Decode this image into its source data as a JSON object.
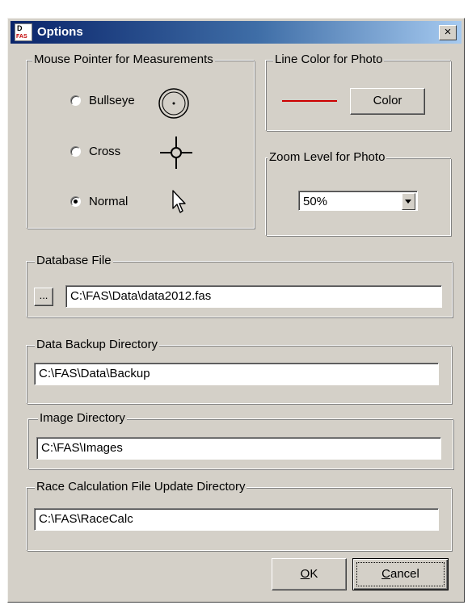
{
  "window": {
    "title": "Options",
    "icon": "fas-app-icon",
    "icon_text_top": "D",
    "icon_text_bottom": "FAS",
    "close_label": "×"
  },
  "mouse_pointer": {
    "title": "Mouse Pointer for Measurements",
    "options": [
      {
        "label": "Bullseye",
        "icon": "bullseye-icon",
        "selected": false
      },
      {
        "label": "Cross",
        "icon": "crosshair-icon",
        "selected": false
      },
      {
        "label": "Normal",
        "icon": "arrow-pointer-icon",
        "selected": true
      }
    ]
  },
  "line_color": {
    "title": "Line Color for Photo",
    "button_label": "Color",
    "swatch_color": "#cc0000"
  },
  "zoom": {
    "title": "Zoom Level for Photo",
    "value": "50%"
  },
  "database": {
    "title": "Database File",
    "browse_label": "...",
    "path": "C:\\FAS\\Data\\data2012.fas"
  },
  "backup": {
    "title": "Data Backup Directory",
    "path": "C:\\FAS\\Data\\Backup"
  },
  "image": {
    "title": "Image  Directory",
    "path": "C:\\FAS\\Images"
  },
  "race_calc": {
    "title": "Race Calculation File Update Directory",
    "path": "C:\\FAS\\RaceCalc"
  },
  "buttons": {
    "ok_mnemonic": "O",
    "ok_rest": "K",
    "cancel_mnemonic": "C",
    "cancel_rest": "ancel"
  }
}
